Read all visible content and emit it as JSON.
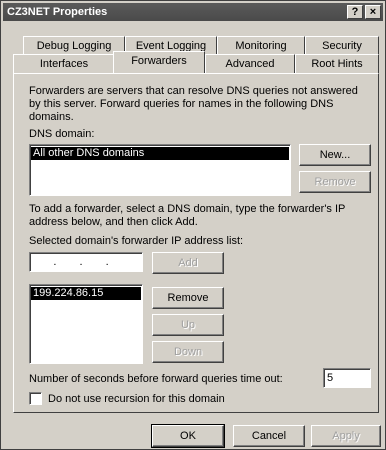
{
  "window": {
    "title": "CZ3NET Properties",
    "help_label": "?",
    "close_label": "×"
  },
  "tabs": {
    "row1": [
      "Debug Logging",
      "Event Logging",
      "Monitoring",
      "Security"
    ],
    "row2": [
      "Interfaces",
      "Forwarders",
      "Advanced",
      "Root Hints"
    ],
    "active": "Forwarders"
  },
  "forwarders": {
    "description": "Forwarders are servers that can resolve DNS queries not answered by this server. Forward queries for names in the following DNS domains.",
    "dns_domain_label": "DNS domain:",
    "dns_domains": [
      "All other DNS domains"
    ],
    "new_button": "New...",
    "remove_domain_button": "Remove",
    "instructions": "To add a forwarder, select a DNS domain, type the forwarder's IP address below, and then click Add.",
    "ip_list_label": "Selected domain's forwarder IP address list:",
    "ip_input_value": ". . .",
    "add_button": "Add",
    "ip_addresses": [
      "199.224.86.15"
    ],
    "remove_button": "Remove",
    "up_button": "Up",
    "down_button": "Down",
    "timeout_label": "Number of seconds before forward queries time out:",
    "timeout_value": "5",
    "no_recursion_label": "Do not use recursion for this domain",
    "no_recursion_checked": false
  },
  "footer": {
    "ok": "OK",
    "cancel": "Cancel",
    "apply": "Apply"
  }
}
